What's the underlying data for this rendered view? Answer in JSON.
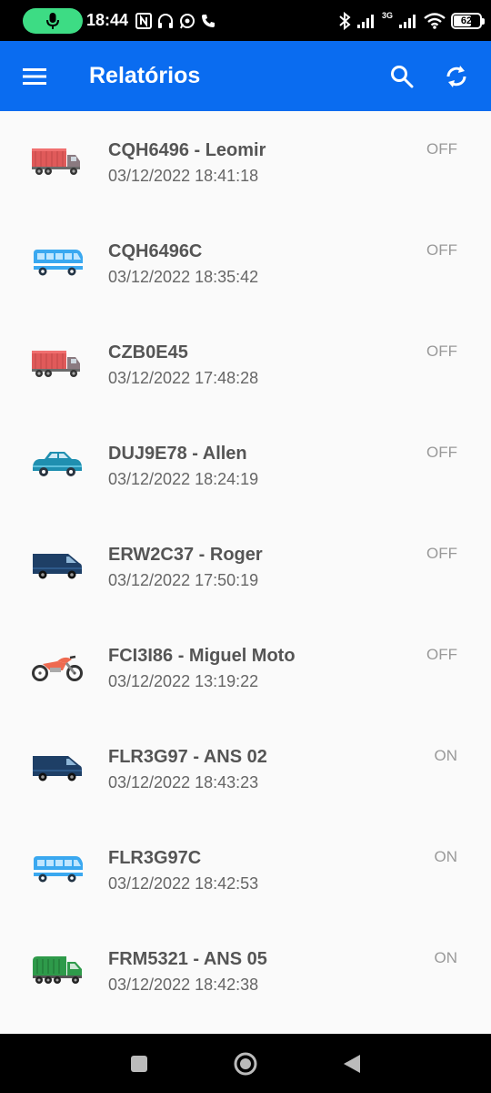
{
  "status_bar": {
    "time": "18:44",
    "network_label": "3G",
    "battery_level": "62"
  },
  "app_bar": {
    "title": "Relatórios"
  },
  "vehicles": [
    {
      "name": "CQH6496 - Leomir",
      "timestamp": "03/12/2022 18:41:18",
      "status": "OFF",
      "icon": "truck-icon"
    },
    {
      "name": "CQH6496C",
      "timestamp": "03/12/2022 18:35:42",
      "status": "OFF",
      "icon": "bus-icon"
    },
    {
      "name": "CZB0E45",
      "timestamp": "03/12/2022 17:48:28",
      "status": "OFF",
      "icon": "truck-icon"
    },
    {
      "name": "DUJ9E78 - Allen",
      "timestamp": "03/12/2022 18:24:19",
      "status": "OFF",
      "icon": "car-icon"
    },
    {
      "name": "ERW2C37 - Roger",
      "timestamp": "03/12/2022 17:50:19",
      "status": "OFF",
      "icon": "van-icon"
    },
    {
      "name": "FCI3I86 - Miguel Moto",
      "timestamp": "03/12/2022 13:19:22",
      "status": "OFF",
      "icon": "motorcycle-icon"
    },
    {
      "name": "FLR3G97 - ANS 02",
      "timestamp": "03/12/2022 18:43:23",
      "status": "ON",
      "icon": "van-icon"
    },
    {
      "name": "FLR3G97C",
      "timestamp": "03/12/2022 18:42:53",
      "status": "ON",
      "icon": "bus-icon"
    },
    {
      "name": "FRM5321 - ANS 05",
      "timestamp": "03/12/2022 18:42:38",
      "status": "ON",
      "icon": "garbage-truck-icon"
    }
  ]
}
